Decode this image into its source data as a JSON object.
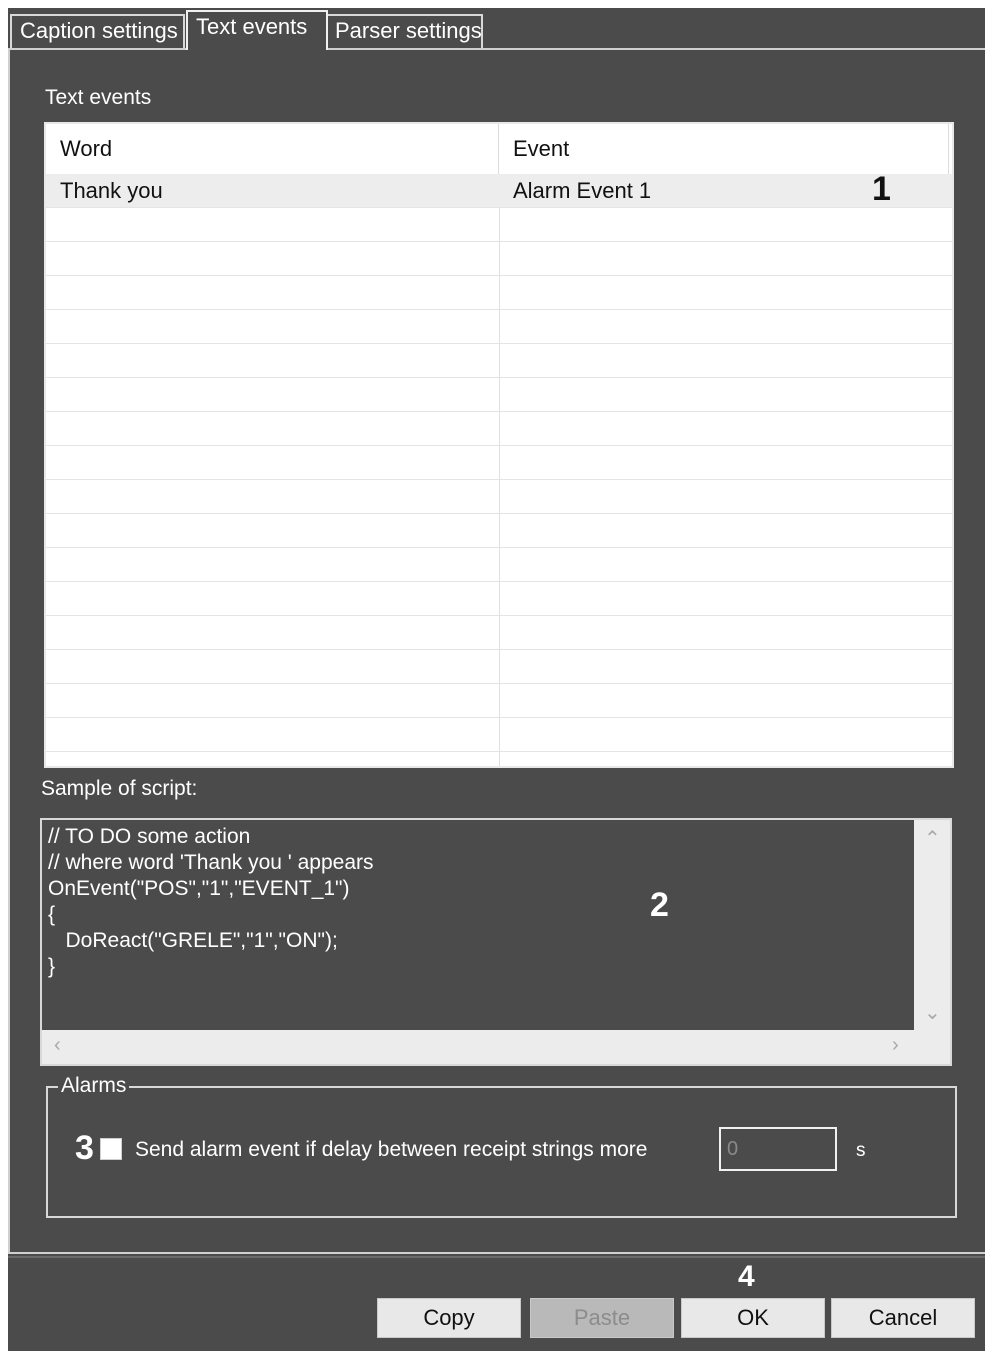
{
  "tabs": [
    {
      "label": "Caption settings",
      "active": false
    },
    {
      "label": "Text events",
      "active": true
    },
    {
      "label": "Parser settings",
      "active": false
    }
  ],
  "text_events": {
    "section_label": "Text events",
    "columns": [
      "Word",
      "Event"
    ],
    "rows": [
      {
        "word": "Thank you",
        "event": "Alarm Event 1",
        "selected": true
      }
    ]
  },
  "script": {
    "label": "Sample of script:",
    "lines": [
      "// TO DO some action",
      "// where word 'Thank you ' appears",
      "OnEvent(\"POS\",\"1\",\"EVENT_1\")",
      "{",
      "   DoReact(\"GRELE\",\"1\",\"ON\");",
      "}"
    ]
  },
  "alarms": {
    "group_label": "Alarms",
    "checkbox_label": "Send alarm event if delay between receipt strings more",
    "checked": false,
    "delay_value": "0",
    "unit": "s"
  },
  "buttons": {
    "copy": "Copy",
    "paste": "Paste",
    "ok": "OK",
    "cancel": "Cancel"
  },
  "callouts": {
    "c1": "1",
    "c2": "2",
    "c3": "3",
    "c4": "4"
  },
  "colors": {
    "panel_background": "#4b4b4b",
    "list_background": "#ffffff",
    "selected_row": "#ededed"
  }
}
